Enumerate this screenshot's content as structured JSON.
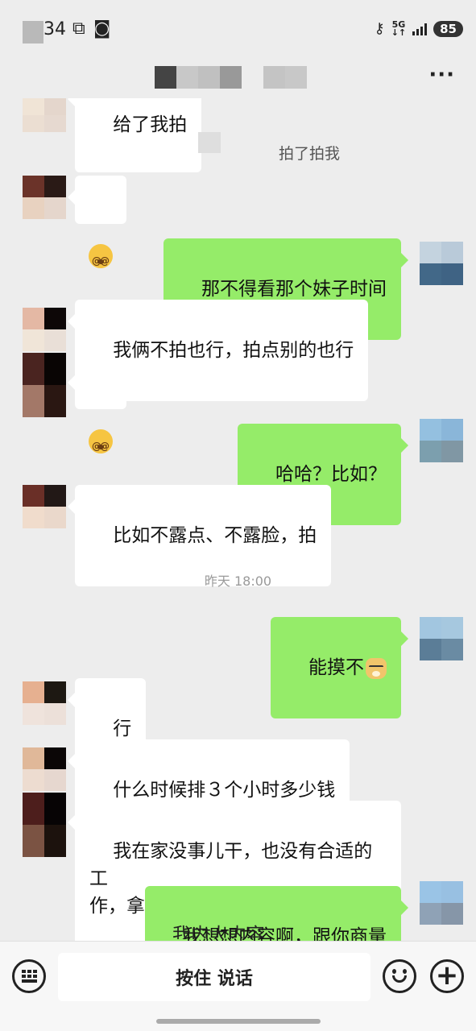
{
  "status_bar": {
    "time": "34",
    "net_label_top": "5G",
    "net_label_bottom": "↓↑",
    "battery": "85",
    "icons": [
      "screenshot-icon",
      "battery-saver-icon",
      "key-icon",
      "signal-icon"
    ]
  },
  "header": {
    "title_blur_colors": [
      "#444444",
      "#c8c8c8",
      "#c0c0c0",
      "#999999",
      "#ededed",
      "#c4c4c4",
      "#c8c8c8"
    ],
    "more_label": "···"
  },
  "chat": {
    "top_partial_text": "给了我拍",
    "system_note": "拍了拍我",
    "time_separator": "昨天 18:00",
    "messages": [
      {
        "id": "m1",
        "side": "in",
        "text": "",
        "emoji": "dizzy-face-emoji",
        "avatar_colors": [
          "#6b3329",
          "#2a1a16",
          "#e8d2c0",
          "#e5d6cc"
        ]
      },
      {
        "id": "m2",
        "side": "out",
        "text": "那不得看那个妹子时间",
        "avatar_colors": [
          "#c4d3df",
          "#b9cad9",
          "#426888",
          "#3f6384"
        ]
      },
      {
        "id": "m3",
        "side": "in",
        "text": "我俩不拍也行，拍点别的也行",
        "avatar_colors": [
          "#e4b8a4",
          "#0d0707",
          "#f0e5d8",
          "#e9dfd7"
        ]
      },
      {
        "id": "m4",
        "side": "in",
        "text": "",
        "emoji": "dizzy-face-emoji",
        "avatar_colors": [
          "#4a2420",
          "#090504",
          "#a37868",
          "#2a1712"
        ]
      },
      {
        "id": "m5",
        "side": "out",
        "text": "哈哈？比如？",
        "avatar_colors": [
          "#94c0e0",
          "#8ab6d9",
          "#7c9fae",
          "#8097a4"
        ]
      },
      {
        "id": "m6",
        "side": "in",
        "text": "比如不露点、不露脸，拍",
        "avatar_colors": [
          "#6a2f27",
          "#221816",
          "#f0dccc",
          "#ead8cb"
        ]
      },
      {
        "id": "m7",
        "side": "out",
        "text": "能摸不",
        "emoji": "doge-emoji",
        "avatar_colors": [
          "#a2c6e0",
          "#a6c8df",
          "#5b7d97",
          "#6a8ba3"
        ]
      },
      {
        "id": "m8",
        "side": "in",
        "text": "行",
        "avatar_colors": [
          "#e6b090",
          "#1d1812",
          "#efe3dc",
          "#ece0d9"
        ]
      },
      {
        "id": "m9",
        "side": "in",
        "text": "什么时候排３个小时多少钱",
        "avatar_colors": [
          "#e0b899",
          "#0b0606",
          "#eddcd0",
          "#e6d7cf"
        ]
      },
      {
        "id": "m10",
        "side": "in",
        "text": "我在家没事儿干，也没有合适的工\n作，拿你这些当个工作干吧",
        "avatar_colors": [
          "#4d1e1c",
          "#070405",
          "#7b5343",
          "#1c120d"
        ]
      },
      {
        "id": "m11",
        "side": "out",
        "text": "我想想内容啊，跟你商量",
        "avatar_colors": [
          "#9ac4e6",
          "#98c0e2",
          "#8fa2b6",
          "#8696a8"
        ]
      }
    ],
    "overlay_partial_text": "我内大内容"
  },
  "input_bar": {
    "hold_to_talk_label": "按住 说话"
  }
}
